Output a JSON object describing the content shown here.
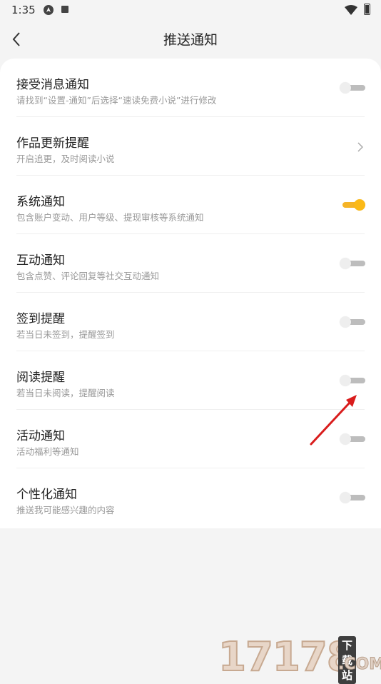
{
  "status_bar": {
    "time": "1:35",
    "icons": [
      "navigation-icon",
      "a-badge-icon",
      "wifi-icon",
      "battery-icon"
    ]
  },
  "header": {
    "title": "推送通知",
    "back_icon": "chevron-left-icon"
  },
  "settings": [
    {
      "title": "接受消息通知",
      "desc": "请找到“设置-通知”后选择“速读免费小说”进行修改",
      "control": "toggle",
      "on": false
    },
    {
      "title": "作品更新提醒",
      "desc": "开启追更，及时阅读小说",
      "control": "chevron",
      "on": false
    },
    {
      "title": "系统通知",
      "desc": "包含账户变动、用户等级、提现审核等系统通知",
      "control": "toggle",
      "on": true
    },
    {
      "title": "互动通知",
      "desc": "包含点赞、评论回复等社交互动通知",
      "control": "toggle",
      "on": false
    },
    {
      "title": "签到提醒",
      "desc": "若当日未签到，提醒签到",
      "control": "toggle",
      "on": false
    },
    {
      "title": "阅读提醒",
      "desc": "若当日未阅读，提醒阅读",
      "control": "toggle",
      "on": false
    },
    {
      "title": "活动通知",
      "desc": "活动福利等通知",
      "control": "toggle",
      "on": false
    },
    {
      "title": "个性化通知",
      "desc": "推送我可能感兴趣的内容",
      "control": "toggle",
      "on": false
    }
  ],
  "colors": {
    "accent": "#fbb917",
    "toggle_off_track": "#bdbdbd",
    "annotation_arrow": "#d91c1c"
  },
  "watermark": {
    "number": "17178",
    "badge": "下载站",
    "suffix": ".COM"
  }
}
